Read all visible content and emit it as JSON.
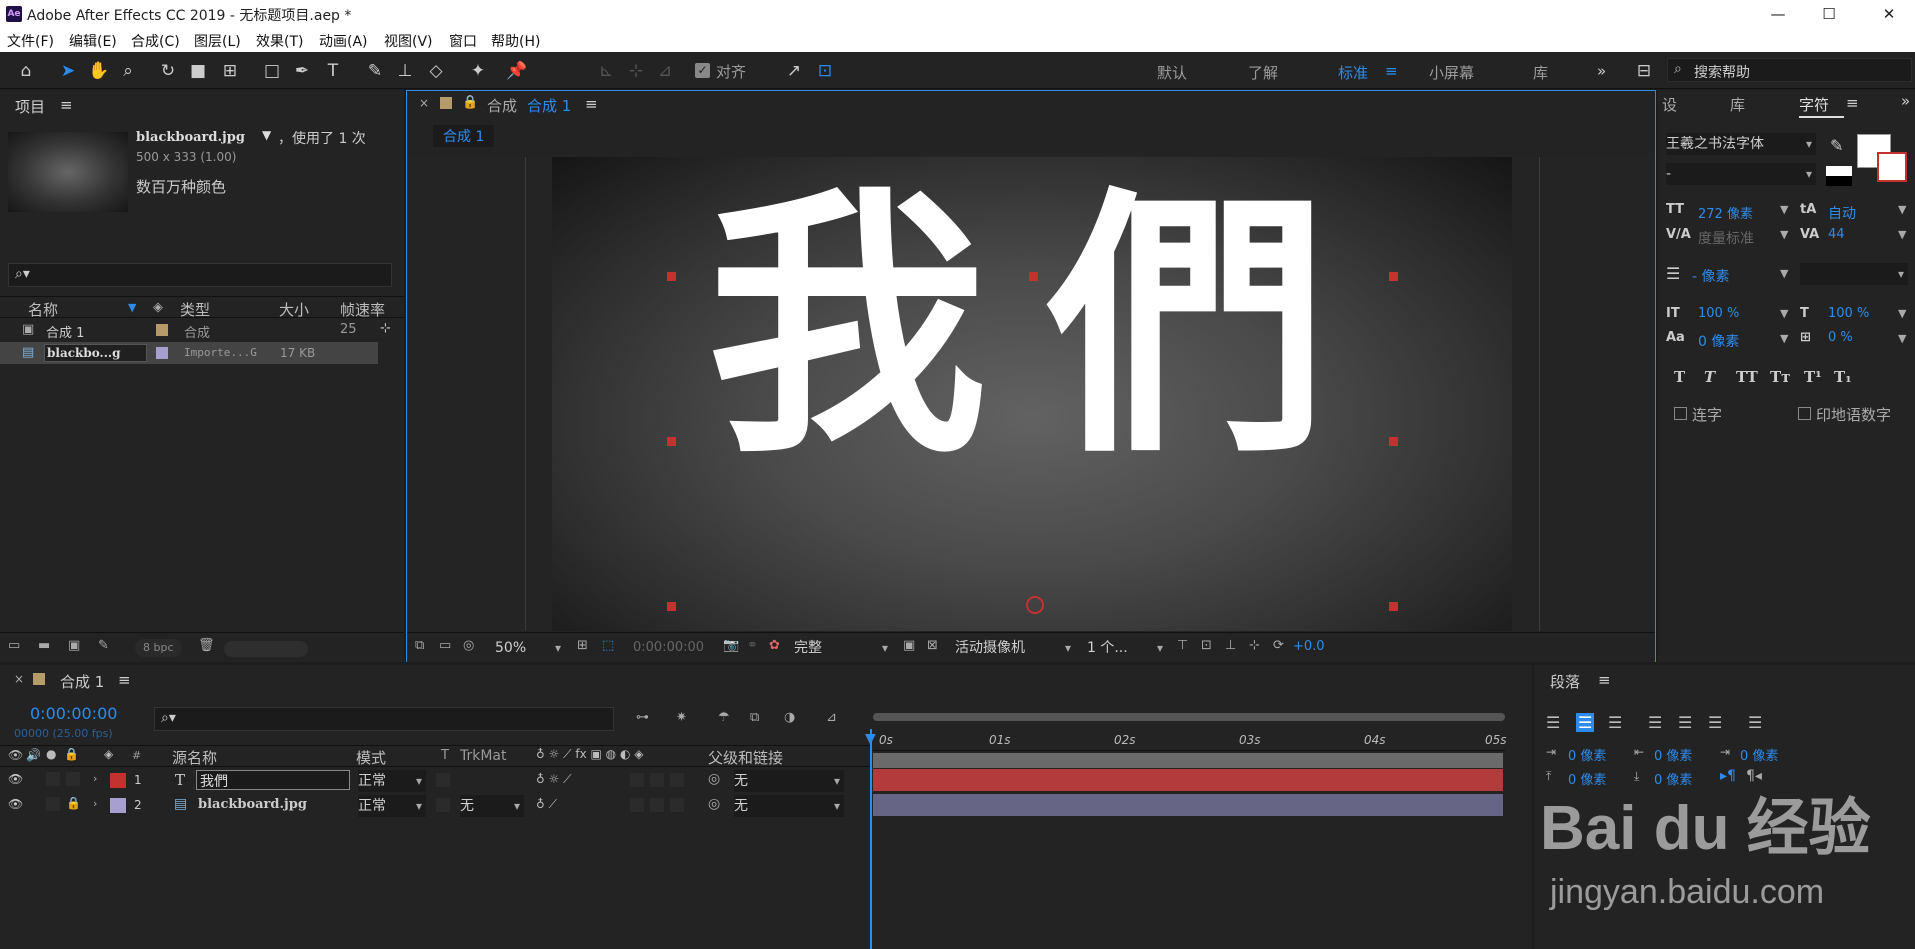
{
  "window": {
    "title": "Adobe After Effects CC 2019 - 无标题项目.aep *",
    "app_icon": "Ae",
    "minimize": "—",
    "maximize": "☐",
    "close": "✕"
  },
  "menu": [
    "文件(F)",
    "编辑(E)",
    "合成(C)",
    "图层(L)",
    "效果(T)",
    "动画(A)",
    "视图(V)",
    "窗口",
    "帮助(H)"
  ],
  "toolbar": {
    "align_label": "对齐",
    "workspaces": [
      "默认",
      "了解",
      "标准",
      "小屏幕",
      "库"
    ],
    "active_workspace": "标准",
    "search_placeholder": "搜索帮助"
  },
  "project": {
    "title": "项目",
    "file_name": "blackboard.jpg",
    "usage": "，使用了 1 次",
    "dims": "500 x 333 (1.00)",
    "color_info": "数百万种颜色",
    "search_placeholder": "",
    "columns": [
      "名称",
      "类型",
      "大小",
      "帧速率"
    ],
    "items": [
      {
        "name": "合成 1",
        "type": "合成",
        "size": "",
        "fps": "25",
        "color": "#b59a6a"
      },
      {
        "name": "blackbo...g",
        "type": "Importe...G",
        "size": "17 KB",
        "fps": "",
        "color": "#a7a0cf"
      }
    ],
    "bpc": "8 bpc"
  },
  "comp_viewer": {
    "panel_prefix": "合成",
    "comp_name": "合成 1",
    "tab": "合成 1",
    "text": "我們",
    "zoom": "50%",
    "timecode": "0:00:00:00",
    "quality": "完整",
    "camera": "活动摄像机",
    "views": "1 个...",
    "exposure": "+0.0"
  },
  "character": {
    "tabs": [
      "设",
      "库",
      "字符"
    ],
    "active_tab": "字符",
    "font": "王羲之书法字体",
    "style": "-",
    "size": "272 像素",
    "leading": "自动",
    "kerning": "度量标准",
    "tracking": "44",
    "stroke": "- 像素",
    "vscale": "100 %",
    "hscale": "100 %",
    "baseline": "0 像素",
    "tsume": "0 %",
    "ligatures": "连字",
    "hindi_digits": "印地语数字"
  },
  "timeline": {
    "comp_name": "合成 1",
    "timecode": "0:00:00:00",
    "frame_info": "00000 (25.00 fps)",
    "search_placeholder": "",
    "columns": [
      "#",
      "源名称",
      "模式",
      "T",
      "TrkMat",
      "父级和链接"
    ],
    "ruler": [
      "0s",
      "01s",
      "02s",
      "03s",
      "04s",
      "05s"
    ],
    "layers": [
      {
        "num": "1",
        "name": "我們",
        "mode": "正常",
        "trkmat": "",
        "parent": "无",
        "color": "#c4322f",
        "kind": "T"
      },
      {
        "num": "2",
        "name": "blackboard.jpg",
        "mode": "正常",
        "trkmat": "无",
        "parent": "无",
        "color": "#a7a0cf",
        "kind": "img"
      }
    ]
  },
  "paragraph": {
    "title": "段落",
    "indent_left": "0 像素",
    "indent_right": "0 像素",
    "first_line": "0 像素",
    "space_before": "0 像素",
    "space_after": "0 像素"
  },
  "watermark": {
    "brand": "Bai du 经验",
    "url": "jingyan.baidu.com"
  }
}
